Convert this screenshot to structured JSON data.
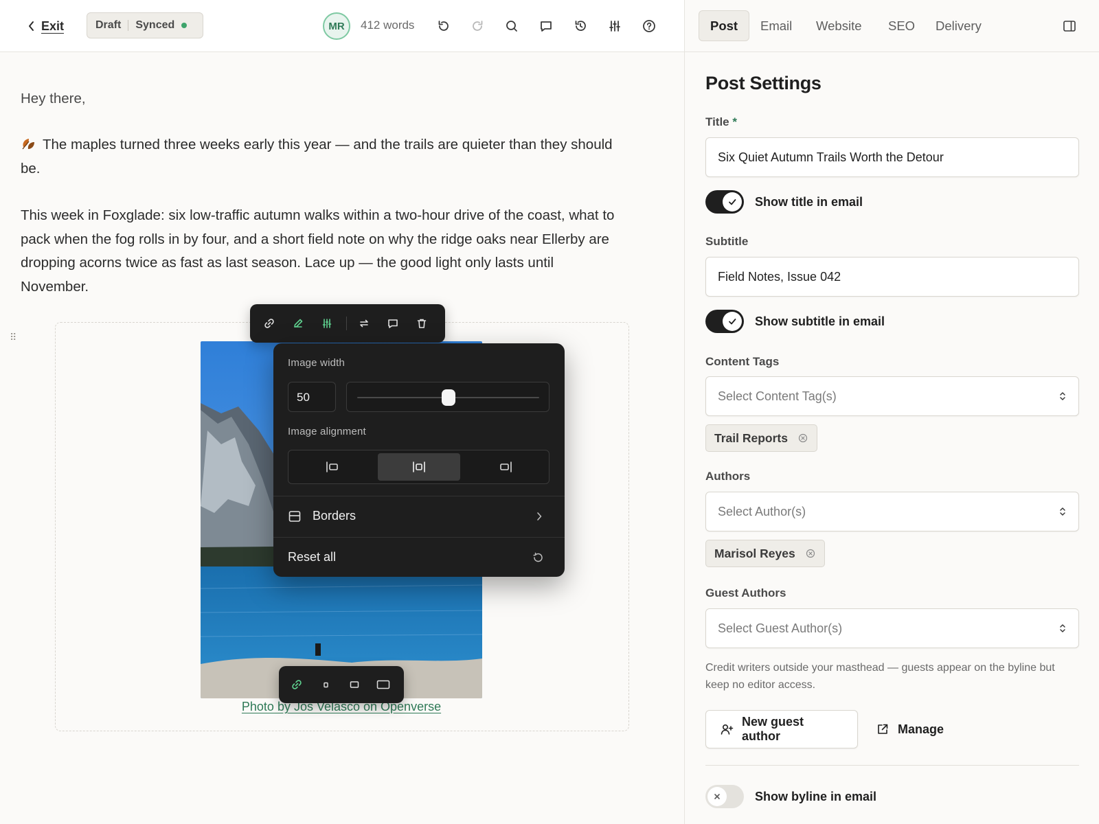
{
  "toolbar": {
    "exit_label": "Exit",
    "status_draft": "Draft",
    "status_synced": "Synced",
    "avatar_initials": "MR",
    "word_count": "412 words",
    "icons": [
      "undo-icon",
      "redo-icon",
      "search-icon",
      "comment-icon",
      "history-icon",
      "sliders-icon",
      "help-icon"
    ]
  },
  "editor": {
    "greeting": "Hey there,",
    "paragraph_1": "The maples turned three weeks early this year — and the trails are quieter than they should be.",
    "paragraph_2": "This week in Foxglade: six low-traffic autumn walks within a two-hour drive of the coast, what to pack when the fog rolls in by four, and a short field note on why the ridge oaks near Ellerby are dropping acorns twice as fast as last season. Lace up — the good light only lasts until November.",
    "image_caption": "Photo by Jos Velasco on Openverse"
  },
  "image_settings": {
    "width_label": "Image width",
    "width_value": "50",
    "width_slider_fraction": 0.5,
    "alignment_label": "Image alignment",
    "alignment_selected": "center",
    "borders_label": "Borders",
    "reset_label": "Reset all"
  },
  "sidebar": {
    "tabs": [
      "Post",
      "Email",
      "Website",
      "SEO",
      "Delivery"
    ],
    "active_tab": "Post",
    "heading": "Post Settings",
    "title_label": "Title",
    "title_required_mark": "*",
    "title_value": "Six Quiet Autumn Trails Worth the Detour",
    "show_title_label": "Show title in email",
    "show_title_on": true,
    "subtitle_label": "Subtitle",
    "subtitle_value": "Field Notes, Issue 042",
    "show_subtitle_label": "Show subtitle in email",
    "show_subtitle_on": true,
    "content_tags_label": "Content Tags",
    "content_tags_placeholder": "Select Content Tag(s)",
    "content_tag_chip": "Trail Reports",
    "authors_label": "Authors",
    "authors_placeholder": "Select Author(s)",
    "author_chip": "Marisol Reyes",
    "guest_authors_label": "Guest Authors",
    "guest_authors_placeholder": "Select Guest Author(s)",
    "guest_help": "Credit writers outside your masthead — guests appear on the byline but keep no editor access.",
    "new_guest_label": "New guest author",
    "manage_label": "Manage",
    "show_byline_label": "Show byline in email",
    "show_byline_on": false
  },
  "colors": {
    "accent_green": "#2f7a57",
    "status_dot": "#3ea46b",
    "toolbar_dark": "#1e1e1e",
    "toggle_on": "#1f1f1f"
  }
}
